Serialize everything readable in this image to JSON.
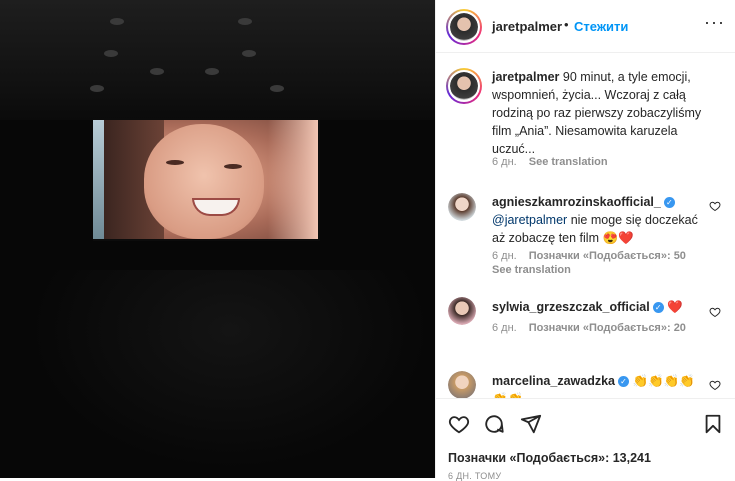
{
  "post": {
    "username": "jaretpalmer",
    "separator": "•",
    "follow_label": "Стежити",
    "more_label": "···"
  },
  "caption": {
    "username": "jaretpalmer",
    "text": " 90 minut, a tyle emocji, wspomnień, życia... Wczoraj z całą rodziną po raz pierwszy zobaczyliśmy film „Ania”. Niesamowita karuzela uczuć...",
    "age": "6 дн.",
    "see_translation": "See translation"
  },
  "comments": [
    {
      "username": "agnieszkamrozinskaofficial_",
      "mention": "@jaretpalmer",
      "text": " nie moge się doczekać aż zobaczę ten film 😍❤️",
      "age": "6 дн.",
      "likes": "Позначки «Подобається»: 50",
      "see_translation": "See translation"
    },
    {
      "username": "sylwia_grzeszczak_official",
      "text": " ❤️",
      "age": "6 дн.",
      "likes": "Позначки «Подобається»: 20"
    },
    {
      "username": "marcelina_zawadzka",
      "text": " 👏👏👏👏👏👏"
    }
  ],
  "footer": {
    "likes": "Позначки «Подобається»: 13,241",
    "time": "6 ДН. ТОМУ"
  },
  "icons": [
    "heart-icon",
    "comment-icon",
    "share-icon",
    "bookmark-icon",
    "verified-icon",
    "more-icon"
  ],
  "colors": {
    "accent": "#0095f6",
    "verified": "#3897f0",
    "text": "#262626",
    "muted": "#8e8e8e"
  }
}
